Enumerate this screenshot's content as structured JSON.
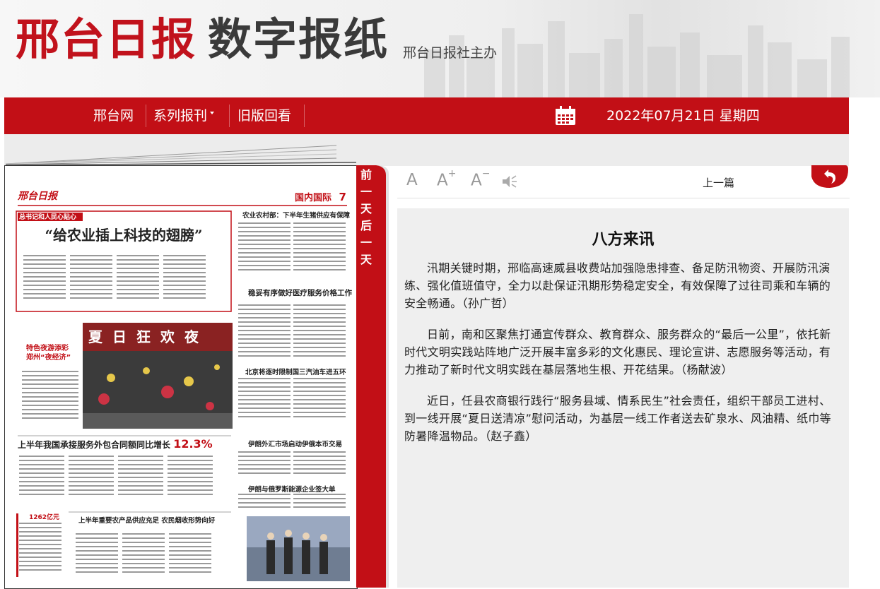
{
  "masthead": {
    "brand_red": "邢台日报",
    "brand_dark": "数字报纸",
    "subtitle": "邢台日报社主办"
  },
  "nav": {
    "items": [
      "邢台网",
      "系列报刊",
      "旧版回看"
    ],
    "date": "2022年07月21日 星期四"
  },
  "ribbon": {
    "text": "前一天后一天",
    "prev_day": "前一天",
    "next_day": "后一天"
  },
  "newspaper": {
    "logo": "邢台日报",
    "page_label": "国内国际",
    "page_number": "7",
    "box_tag": "总书记和人民心贴心",
    "headline_main": "“给农业插上科技的翅膀”",
    "headline_right_1": "农业农村部：下半年生猪供应有保障",
    "headline_right_2": "稳妥有序做好医疗服务价格工作",
    "headline_right_3": "北京将逐时限制国三汽油车进五环",
    "side_caption_1": "特色夜游添彩",
    "side_caption_2": "郑州“夜经济”",
    "photo_banner": "夏日狂欢夜",
    "headline_mid": "上半年我国承接服务外包合同额同比增长",
    "headline_mid_num": "12.3%",
    "headline_right_4": "伊朗外汇市场启动伊俄本币交易",
    "headline_right_5": "伊朗与俄罗斯能源企业签大单",
    "headline_bottom": "上半年重要农产品供应充足 农民烟收形势向好",
    "side_num": "1262亿元"
  },
  "toolbar": {
    "font_normal": "A",
    "font_plus": "A",
    "font_minus": "A",
    "plus_mark": "+",
    "minus_mark": "−",
    "prev_article": "上一篇"
  },
  "article": {
    "title": "八方来讯",
    "paragraphs": [
      "汛期关键时期，邢临高速威县收费站加强隐患排查、备足防汛物资、开展防汛演练、强化值班值守，全力以赴保证汛期形势稳定安全，有效保障了过往司乘和车辆的安全畅通。（孙广哲）",
      "日前，南和区聚焦打通宣传群众、教育群众、服务群众的“最后一公里”，依托新时代文明实践站阵地广泛开展丰富多彩的文化惠民、理论宣讲、志愿服务等活动，有力推动了新时代文明实践在基层落地生根、开花结果。（杨献波）",
      "近日，任县农商银行践行“服务县域、情系民生”社会责任，组织干部员工进村、到一线开展“夏日送清凉”慰问活动，为基层一线工作者送去矿泉水、风油精、纸巾等防暑降温物品。（赵子鑫）"
    ]
  },
  "colors": {
    "accent": "#c20f16",
    "brand_dark": "#3a3a3a",
    "panel_bg": "#efefef"
  }
}
